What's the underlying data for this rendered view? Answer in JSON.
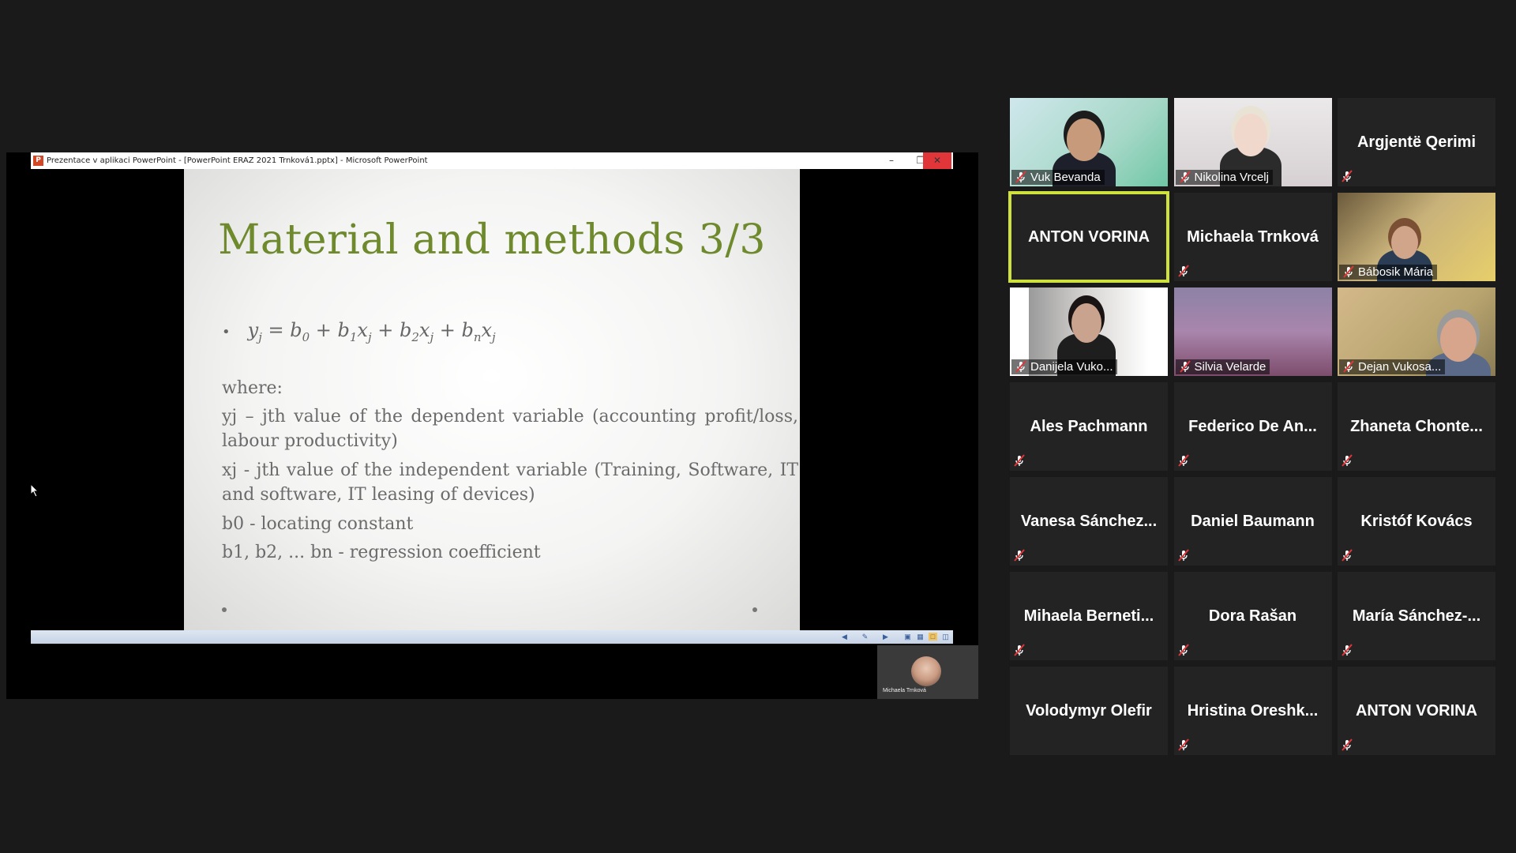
{
  "shared_screen": {
    "window_title": "Prezentace v aplikaci PowerPoint - [PowerPoint ERAZ 2021 Trnková1.pptx] - Microsoft PowerPoint",
    "app_icon": "P",
    "slide": {
      "title": "Material and methods 3/3",
      "formula_icon": "bullet-point",
      "where": "where:",
      "yj_text": "yj – jth value of the dependent variable (accounting profit/loss, labour productivity)",
      "xj_text": "xj - jth value of the independent variable (Training, Software, IT and software, IT leasing of devices)",
      "b0_text": "b0 - locating constant",
      "b1_text": "b1, b2, ... bn - regression coefficient"
    },
    "presenter_name": "Michaela Trnková"
  },
  "colors": {
    "background": "#1a1a1a",
    "tile": "#232323",
    "active_speaker": "#cfe13d",
    "slide_title": "#6e8a2d",
    "muted_mic": "#e0363a"
  },
  "gallery": [
    {
      "name": "Vuk Bevanda",
      "video": true,
      "muted": true
    },
    {
      "name": "Nikolina Vrcelj",
      "video": true,
      "muted": true
    },
    {
      "name": "Argjentë Qerimi",
      "video": false,
      "muted": true
    },
    {
      "name": "ANTON VORINA",
      "video": false,
      "muted": false,
      "active": true
    },
    {
      "name": "Michaela Trnková",
      "video": false,
      "muted": true
    },
    {
      "name": "Bábosik Mária",
      "video": true,
      "muted": true
    },
    {
      "name": "Danijela Vuko...",
      "video": true,
      "muted": true
    },
    {
      "name": "Silvia Velarde",
      "video": true,
      "muted": true
    },
    {
      "name": "Dejan Vukosa...",
      "video": true,
      "muted": true
    },
    {
      "name": "Ales Pachmann",
      "video": false,
      "muted": true
    },
    {
      "name": "Federico De An...",
      "video": false,
      "muted": true
    },
    {
      "name": "Zhaneta Chonte...",
      "video": false,
      "muted": true
    },
    {
      "name": "Vanesa Sánchez...",
      "video": false,
      "muted": true
    },
    {
      "name": "Daniel Baumann",
      "video": false,
      "muted": true
    },
    {
      "name": "Kristóf Kovács",
      "video": false,
      "muted": true
    },
    {
      "name": "Mihaela Berneti...",
      "video": false,
      "muted": true
    },
    {
      "name": "Dora Rašan",
      "video": false,
      "muted": true
    },
    {
      "name": "María Sánchez-...",
      "video": false,
      "muted": true
    },
    {
      "name": "Volodymyr Olefir",
      "video": false,
      "muted": false
    },
    {
      "name": "Hristina Oreshk...",
      "video": false,
      "muted": true
    },
    {
      "name": "ANTON VORINA",
      "video": false,
      "muted": true
    }
  ]
}
